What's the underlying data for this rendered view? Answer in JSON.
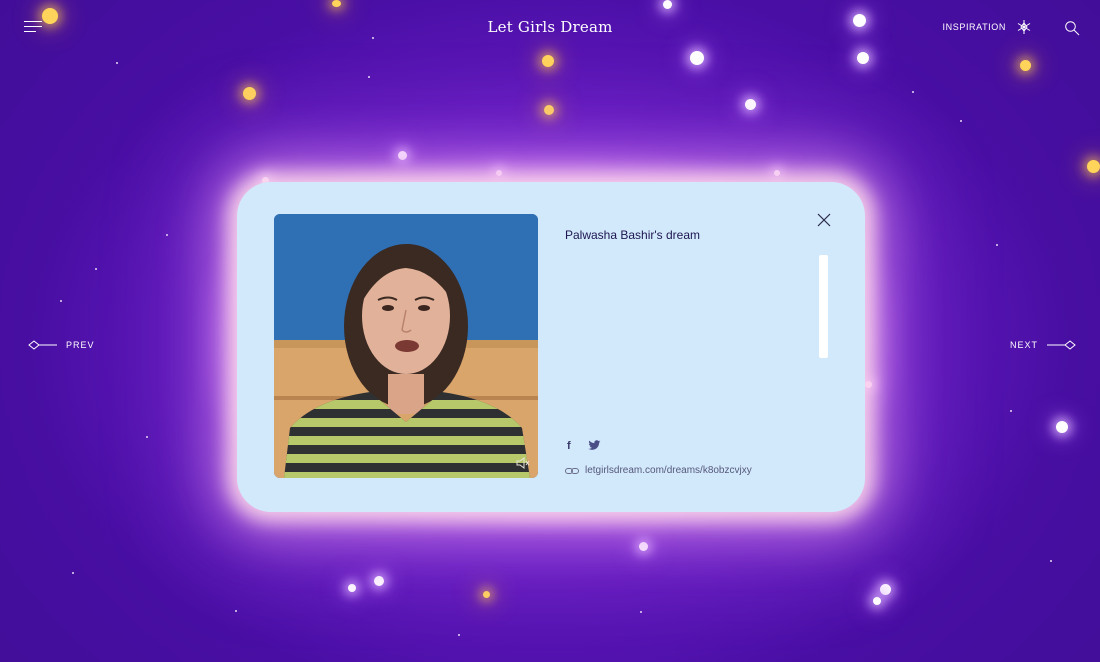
{
  "header": {
    "menu_icon": "hamburger-icon",
    "site_title": "Let Girls Dream",
    "inspiration_label": "INSPIRATION",
    "inspiration_icon": "star-burst-icon",
    "search_icon": "search-icon"
  },
  "navigation": {
    "prev_label": "PREV",
    "next_label": "NEXT"
  },
  "card": {
    "title": "Palwasha Bashir's dream",
    "close_icon": "close-icon",
    "social": {
      "facebook": "f",
      "twitter_icon": "twitter-icon"
    },
    "link_icon": "link-icon",
    "dream_url": "letgirlsdream.com/dreams/k8obzcvjxy",
    "video_mute_icon": "mute-icon"
  },
  "colors": {
    "background": "#4a0fa6",
    "card_background": "#d2e8fb",
    "title_text": "#1d1650",
    "star_gold": "#ffd45a"
  }
}
